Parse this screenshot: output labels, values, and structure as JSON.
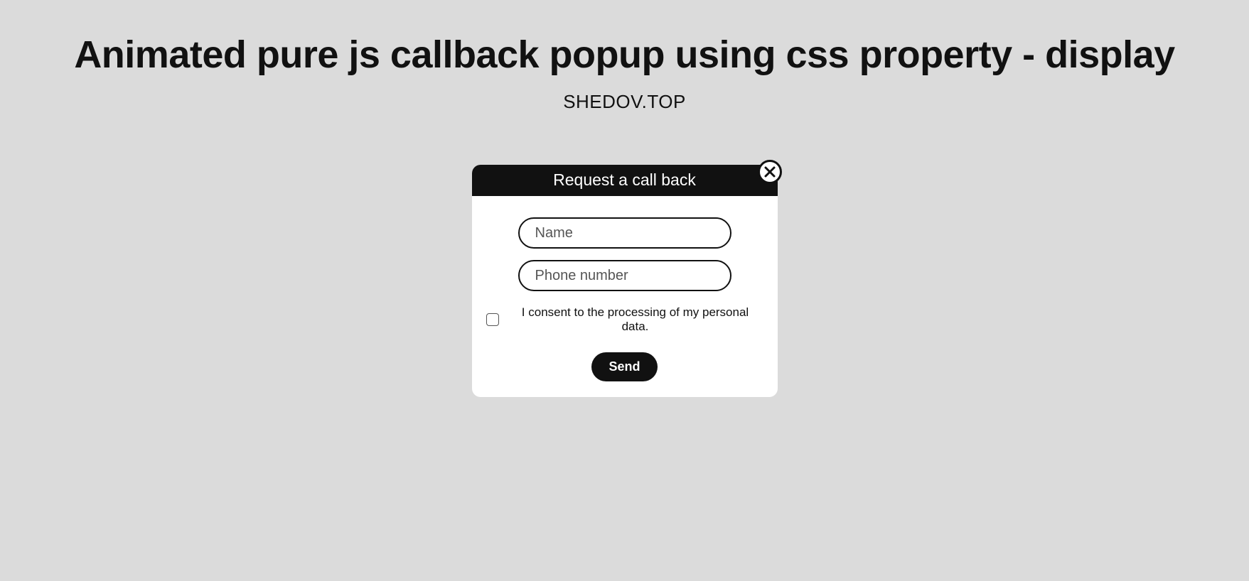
{
  "header": {
    "title": "Animated pure js callback popup using css property - display",
    "subtitle": "SHEDOV.TOP"
  },
  "popup": {
    "title": "Request a call back",
    "name_placeholder": "Name",
    "phone_placeholder": "Phone number",
    "consent_label": "I consent to the processing of my personal data.",
    "send_label": "Send"
  }
}
